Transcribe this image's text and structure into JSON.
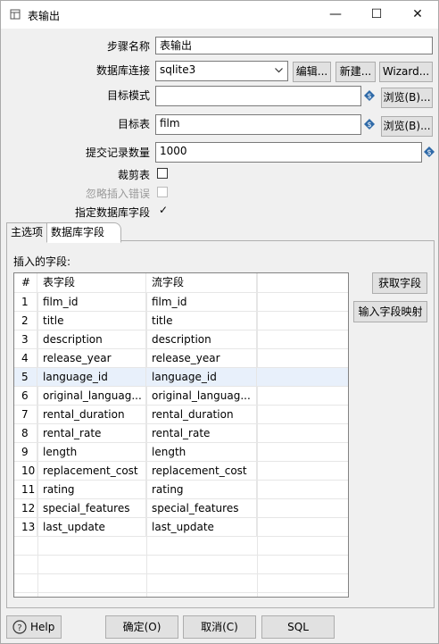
{
  "window": {
    "title": "表输出",
    "minimize": "—",
    "maximize": "☐",
    "close": "✕"
  },
  "form": {
    "step_name_label": "步骤名称",
    "step_name_value": "表输出",
    "connection_label": "数据库连接",
    "connection_value": "sqlite3",
    "edit_btn": "编辑...",
    "new_btn": "新建...",
    "wizard_btn": "Wizard...",
    "schema_label": "目标模式",
    "schema_value": "",
    "browse_btn1": "浏览(B)...",
    "table_label": "目标表",
    "table_value": "film",
    "browse_btn2": "浏览(B)...",
    "commit_label": "提交记录数量",
    "commit_value": "1000",
    "truncate_label": "裁剪表",
    "ignore_errors_label": "忽略插入错误",
    "specify_fields_label": "指定数据库字段",
    "specify_fields_mark": "✓"
  },
  "tabs": [
    {
      "label": "主选项"
    },
    {
      "label": "数据库字段"
    }
  ],
  "fields_panel": {
    "label": "插入的字段:",
    "get_fields_btn": "获取字段",
    "map_btn": "输入字段映射",
    "columns": [
      "#",
      "表字段",
      "流字段"
    ],
    "rows": [
      [
        "1",
        "film_id",
        "film_id"
      ],
      [
        "2",
        "title",
        "title"
      ],
      [
        "3",
        "description",
        "description"
      ],
      [
        "4",
        "release_year",
        "release_year"
      ],
      [
        "5",
        "language_id",
        "language_id"
      ],
      [
        "6",
        "original_languag...",
        "original_languag..."
      ],
      [
        "7",
        "rental_duration",
        "rental_duration"
      ],
      [
        "8",
        "rental_rate",
        "rental_rate"
      ],
      [
        "9",
        "length",
        "length"
      ],
      [
        "10",
        "replacement_cost",
        "replacement_cost"
      ],
      [
        "11",
        "rating",
        "rating"
      ],
      [
        "12",
        "special_features",
        "special_features"
      ],
      [
        "13",
        "last_update",
        "last_update"
      ]
    ]
  },
  "footer": {
    "help": "Help",
    "ok": "确定(O)",
    "cancel": "取消(C)",
    "sql": "SQL"
  }
}
